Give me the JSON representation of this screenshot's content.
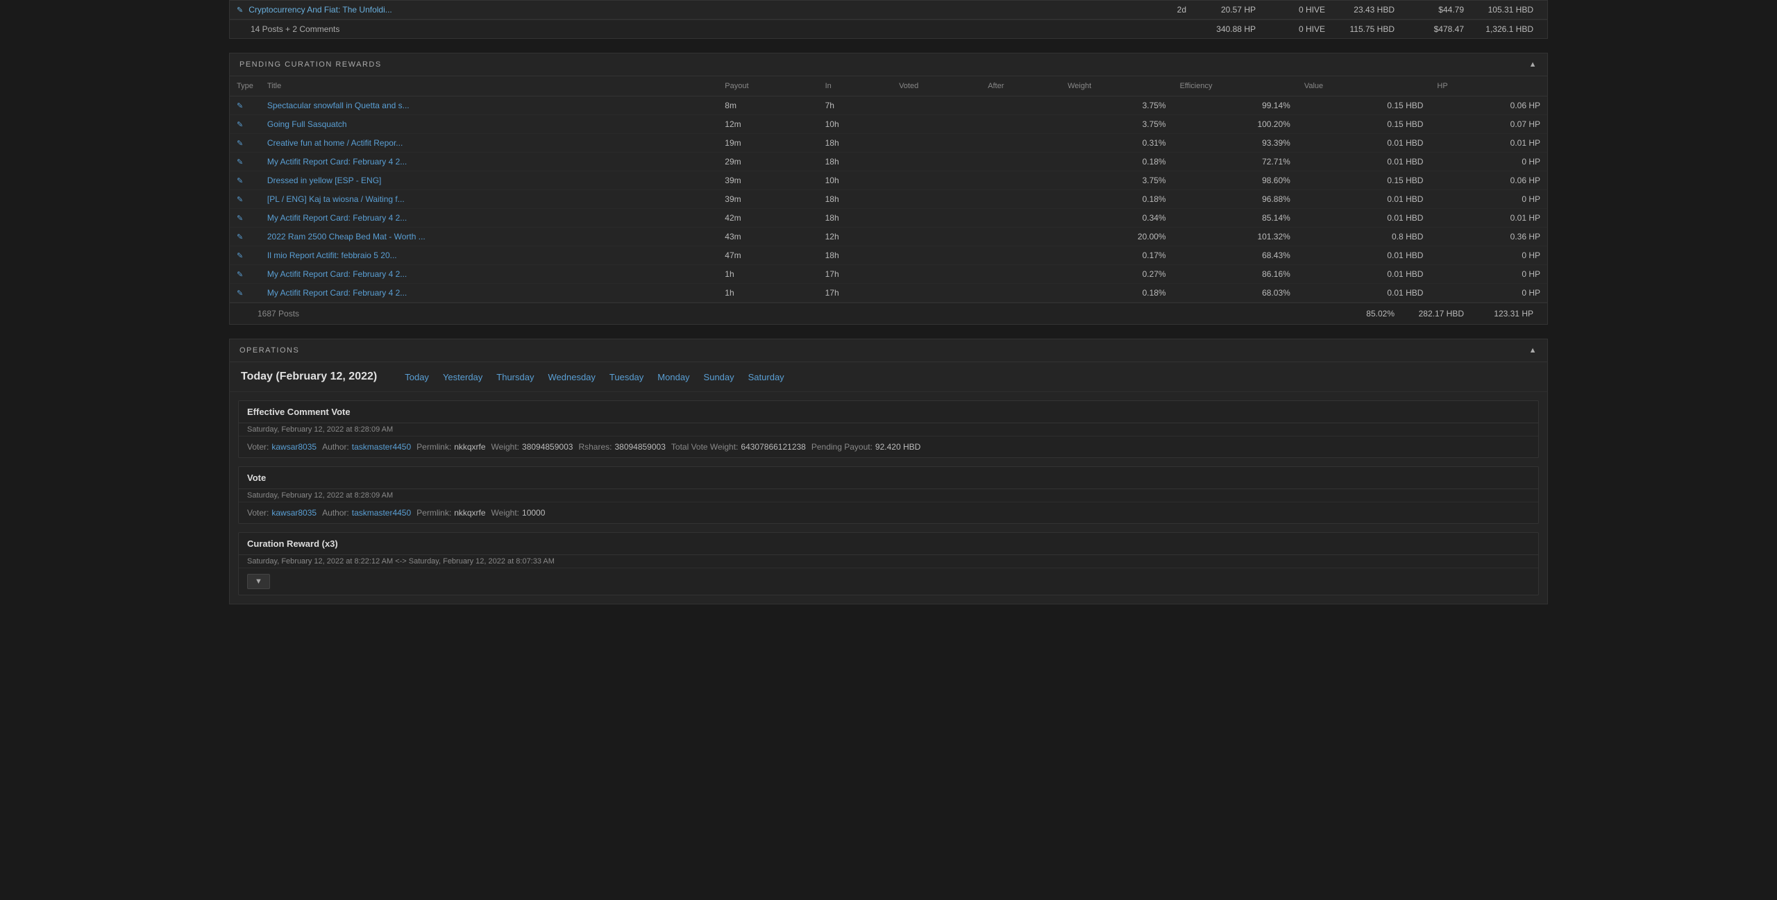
{
  "topSection": {
    "row": {
      "icon": "✎",
      "title": "Cryptocurrency And Fiat: The Unfoldi...",
      "payout": "2d",
      "voted": "20.57 HP",
      "hive": "0 HIVE",
      "hbd": "23.43 HBD",
      "value": "$44.79",
      "hp": "105.31 HBD"
    },
    "totals": {
      "label": "14 Posts + 2 Comments",
      "voted": "340.88 HP",
      "hive": "0 HIVE",
      "hbd": "115.75 HBD",
      "value": "$478.47",
      "hp": "1,326.1 HBD"
    }
  },
  "pendingCuration": {
    "title": "PENDING CURATION REWARDS",
    "columns": [
      "Type",
      "Title",
      "Payout",
      "In",
      "Voted",
      "After",
      "Weight",
      "Efficiency",
      "Value",
      "HP"
    ],
    "rows": [
      {
        "icon": "✎",
        "title": "Spectacular snowfall in Quetta and s...",
        "payout": "8m",
        "in": "7h",
        "weight": "3.75%",
        "efficiency": "99.14%",
        "value": "0.15 HBD",
        "hp": "0.06 HP"
      },
      {
        "icon": "✎",
        "title": "Going Full Sasquatch",
        "payout": "12m",
        "in": "10h",
        "weight": "3.75%",
        "efficiency": "100.20%",
        "value": "0.15 HBD",
        "hp": "0.07 HP"
      },
      {
        "icon": "✎",
        "title": "Creative fun at home / Actifit Repor...",
        "payout": "19m",
        "in": "18h",
        "weight": "0.31%",
        "efficiency": "93.39%",
        "value": "0.01 HBD",
        "hp": "0.01 HP"
      },
      {
        "icon": "✎",
        "title": "My Actifit Report Card: February 4 2...",
        "payout": "29m",
        "in": "18h",
        "weight": "0.18%",
        "efficiency": "72.71%",
        "value": "0.01 HBD",
        "hp": "0 HP"
      },
      {
        "icon": "✎",
        "title": "Dressed in yellow [ESP - ENG]",
        "payout": "39m",
        "in": "10h",
        "weight": "3.75%",
        "efficiency": "98.60%",
        "value": "0.15 HBD",
        "hp": "0.06 HP"
      },
      {
        "icon": "✎",
        "title": "[PL / ENG] Kaj ta wiosna / Waiting f...",
        "payout": "39m",
        "in": "18h",
        "weight": "0.18%",
        "efficiency": "96.88%",
        "value": "0.01 HBD",
        "hp": "0 HP"
      },
      {
        "icon": "✎",
        "title": "My Actifit Report Card: February 4 2...",
        "payout": "42m",
        "in": "18h",
        "weight": "0.34%",
        "efficiency": "85.14%",
        "value": "0.01 HBD",
        "hp": "0.01 HP"
      },
      {
        "icon": "✎",
        "title": "2022 Ram 2500 Cheap Bed Mat - Worth ...",
        "payout": "43m",
        "in": "12h",
        "weight": "20.00%",
        "efficiency": "101.32%",
        "value": "0.8 HBD",
        "hp": "0.36 HP"
      },
      {
        "icon": "✎",
        "title": "Il mio Report Actifit: febbraio 5 20...",
        "payout": "47m",
        "in": "18h",
        "weight": "0.17%",
        "efficiency": "68.43%",
        "value": "0.01 HBD",
        "hp": "0 HP"
      },
      {
        "icon": "✎",
        "title": "My Actifit Report Card: February 4 2...",
        "payout": "1h",
        "in": "17h",
        "weight": "0.27%",
        "efficiency": "86.16%",
        "value": "0.01 HBD",
        "hp": "0 HP"
      },
      {
        "icon": "✎",
        "title": "My Actifit Report Card: February 4 2...",
        "payout": "1h",
        "in": "17h",
        "weight": "0.18%",
        "efficiency": "68.03%",
        "value": "0.01 HBD",
        "hp": "0 HP"
      }
    ],
    "footer": {
      "label": "1687 Posts",
      "efficiency": "85.02%",
      "value": "282.17 HBD",
      "hp": "123.31 HP"
    }
  },
  "operations": {
    "title": "OPERATIONS",
    "currentDate": "Today (February 12, 2022)",
    "navLinks": [
      "Today",
      "Yesterday",
      "Thursday",
      "Wednesday",
      "Tuesday",
      "Monday",
      "Sunday",
      "Saturday"
    ],
    "cards": [
      {
        "type": "Effective Comment Vote",
        "timestamp": "Saturday, February 12, 2022 at 8:28:09 AM",
        "fields": [
          {
            "label": "Voter:",
            "value": "kawsar8035",
            "isLink": true
          },
          {
            "label": "Author:",
            "value": "taskmaster4450",
            "isLink": true
          },
          {
            "label": "Permlink:",
            "value": "nkkqxrfe",
            "isLink": false
          },
          {
            "label": "Weight:",
            "value": "38094859003",
            "isLink": false
          },
          {
            "label": "Rshares:",
            "value": "38094859003",
            "isLink": false
          },
          {
            "label": "Total Vote Weight:",
            "value": "64307866121238",
            "isLink": false
          },
          {
            "label": "Pending Payout:",
            "value": "92.420 HBD",
            "isLink": false
          }
        ]
      },
      {
        "type": "Vote",
        "timestamp": "Saturday, February 12, 2022 at 8:28:09 AM",
        "fields": [
          {
            "label": "Voter:",
            "value": "kawsar8035",
            "isLink": true
          },
          {
            "label": "Author:",
            "value": "taskmaster4450",
            "isLink": true
          },
          {
            "label": "Permlink:",
            "value": "nkkqxrfe",
            "isLink": false
          },
          {
            "label": "Weight:",
            "value": "10000",
            "isLink": false
          }
        ]
      },
      {
        "type": "Curation Reward (x3)",
        "timestamp": "Saturday, February 12, 2022 at 8:22:12 AM <-> Saturday, February 12, 2022 at 8:07:33 AM",
        "fields": [],
        "hasToggle": true,
        "toggleLabel": "▼"
      }
    ]
  }
}
